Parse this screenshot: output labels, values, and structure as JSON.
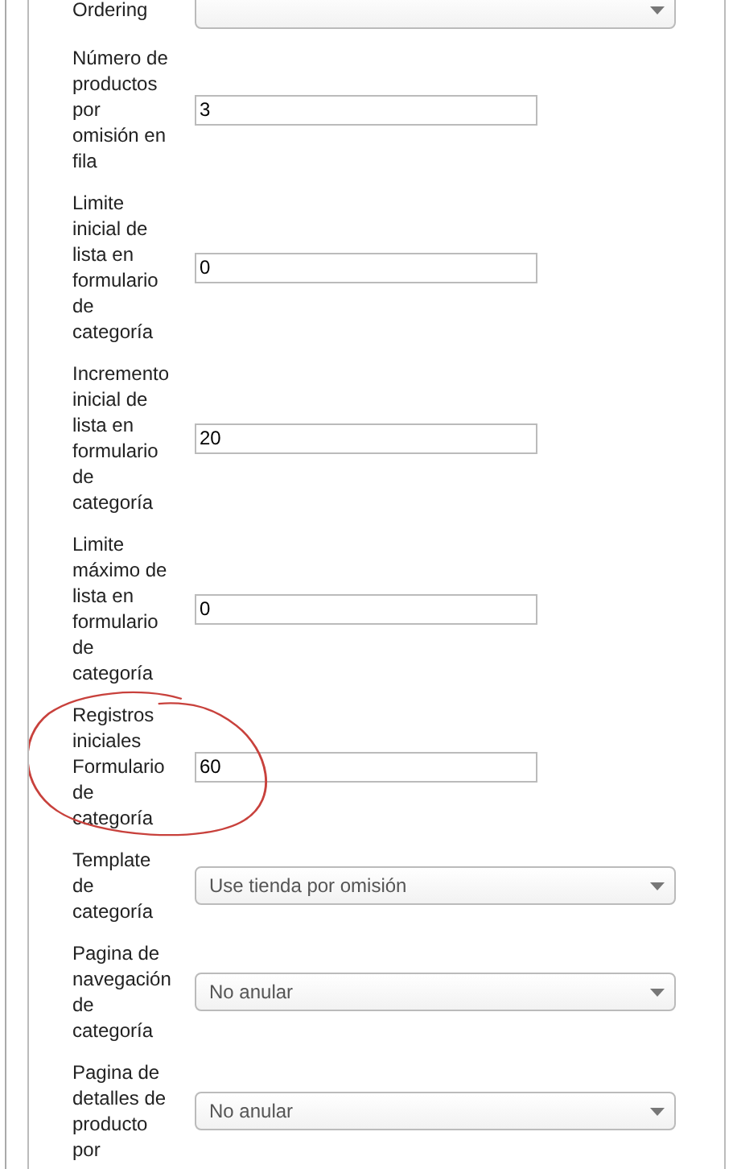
{
  "rows": [
    {
      "kind": "select",
      "label": "Ordering",
      "value": "",
      "highlighted": false
    },
    {
      "kind": "text",
      "label": "Número de productos por omisión en fila",
      "value": "3",
      "highlighted": false
    },
    {
      "kind": "text",
      "label": "Limite inicial de lista en formulario de categoría",
      "value": "0",
      "highlighted": false
    },
    {
      "kind": "text",
      "label": "Incremento inicial de lista en formulario de categoría",
      "value": "20",
      "highlighted": false
    },
    {
      "kind": "text",
      "label": "Limite máximo de lista en formulario de categoría",
      "value": "0",
      "highlighted": false
    },
    {
      "kind": "text",
      "label": "Registros iniciales Formulario de categoría",
      "value": "60",
      "highlighted": true
    },
    {
      "kind": "select",
      "label": "Template de categoría",
      "value": "Use tienda por omisión",
      "highlighted": false
    },
    {
      "kind": "select",
      "label": "Pagina de navegación de categoría",
      "value": "No anular",
      "highlighted": false
    },
    {
      "kind": "select",
      "label": "Pagina de detalles de producto por",
      "value": "No anular",
      "highlighted": false
    }
  ]
}
